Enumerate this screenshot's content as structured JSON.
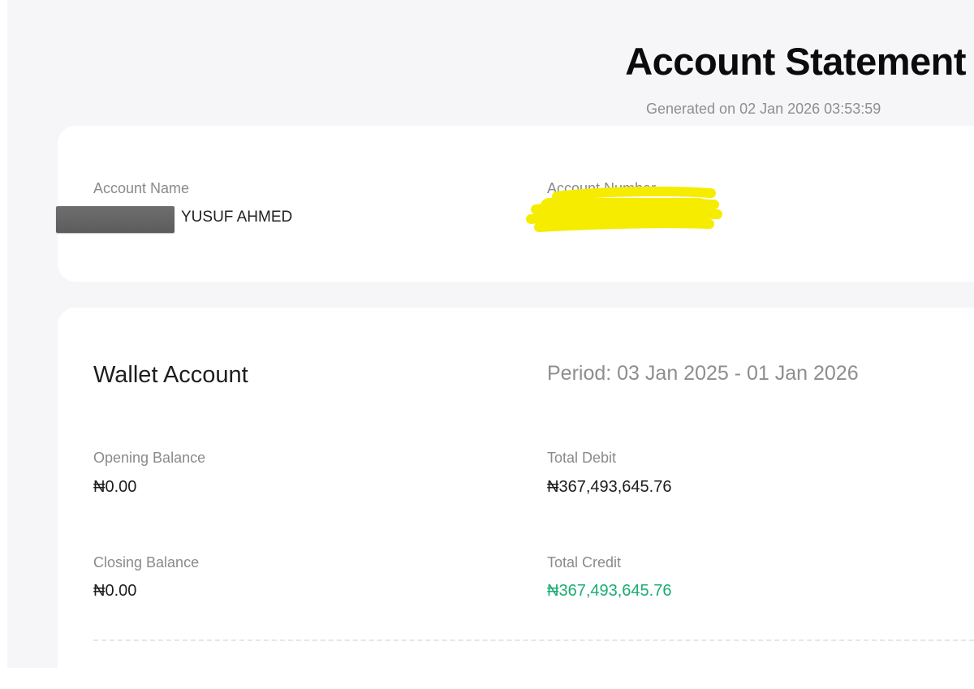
{
  "header": {
    "title": "Account Statement",
    "generated": "Generated on 02 Jan 2026 03:53:59"
  },
  "account": {
    "name_label": "Account Name",
    "name_value": "YUSUF AHMED",
    "number_label": "Account Number"
  },
  "wallet": {
    "title": "Wallet Account",
    "period": "Period: 03 Jan 2025 - 01 Jan 2026",
    "opening_label": "Opening Balance",
    "opening_value": "₦0.00",
    "total_debit_label": "Total Debit",
    "total_debit_value": "₦367,493,645.76",
    "closing_label": "Closing Balance",
    "closing_value": "₦0.00",
    "total_credit_label": "Total Credit",
    "total_credit_value": "₦367,493,645.76"
  },
  "colors": {
    "page_background": "#f6f6f9",
    "card_background": "#ffffff",
    "credit_green": "#19ad72",
    "redaction_yellow": "#f5ec00",
    "redaction_gray": "#646464"
  }
}
